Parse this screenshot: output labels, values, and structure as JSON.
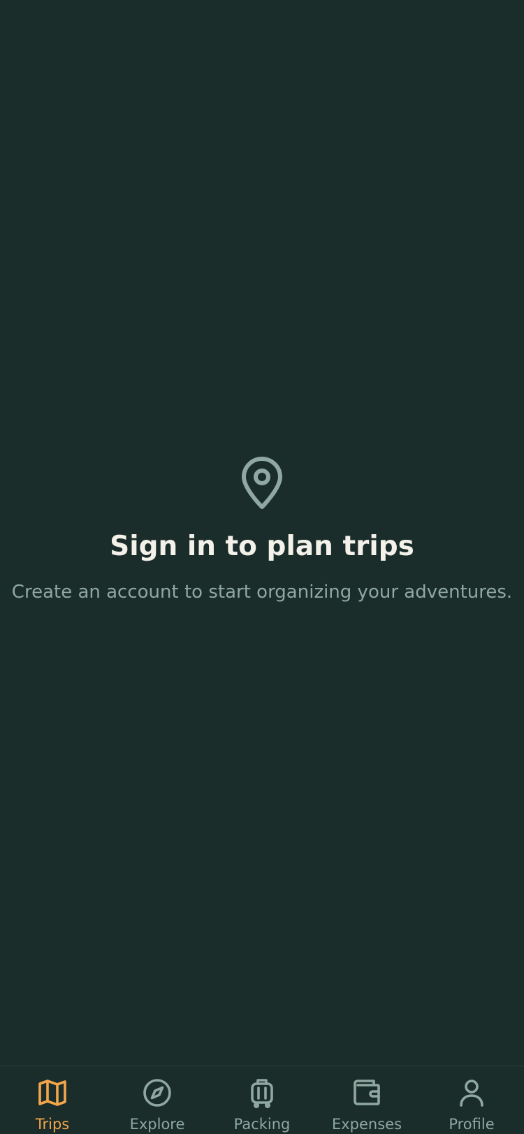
{
  "empty_state": {
    "icon": "map-pin-icon",
    "title": "Sign in to plan trips",
    "subtitle": "Create an account to start organizing your adventures."
  },
  "tab_bar": {
    "active_tab": "Trips",
    "tabs": [
      {
        "label": "Trips",
        "icon": "map-icon"
      },
      {
        "label": "Explore",
        "icon": "compass-icon"
      },
      {
        "label": "Packing",
        "icon": "luggage-icon"
      },
      {
        "label": "Expenses",
        "icon": "wallet-icon"
      },
      {
        "label": "Profile",
        "icon": "user-icon"
      }
    ]
  },
  "colors": {
    "background": "#1b2d2a",
    "title_text": "#f3f1ea",
    "muted_text": "#8fa8a1",
    "accent": "#f3a64a"
  }
}
